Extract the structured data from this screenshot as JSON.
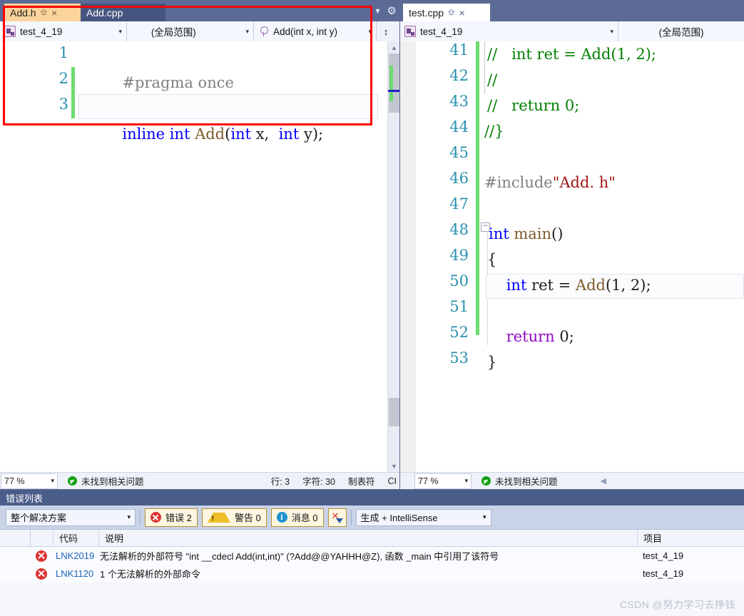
{
  "left_pane": {
    "tabs": [
      {
        "label": "Add.h",
        "state": "active",
        "pin": "pin-icon",
        "close": "×"
      },
      {
        "label": "Add.cpp",
        "state": "inactive"
      }
    ],
    "tab_controls": {
      "overflow": "▾",
      "settings": "gear-icon"
    },
    "nav": {
      "project": "test_4_19",
      "scope": "(全局范围)",
      "member": "Add(int x, int y)",
      "caret": "▾",
      "split": "↕"
    },
    "code": {
      "lines": [
        {
          "num": "1",
          "changed": false,
          "tokens": [
            {
              "t": "#pragma once",
              "c": "k-pre"
            }
          ]
        },
        {
          "num": "2",
          "changed": true,
          "tokens": []
        },
        {
          "num": "3",
          "changed": true,
          "tokens": [
            {
              "t": "inline ",
              "c": "k-kw"
            },
            {
              "t": "int ",
              "c": "k-kw"
            },
            {
              "t": "Add",
              "c": "k-fn"
            },
            {
              "t": "(",
              "c": "k-punct"
            },
            {
              "t": "int ",
              "c": "k-kw"
            },
            {
              "t": "x",
              "c": "k-id"
            },
            {
              "t": ",  ",
              "c": "k-punct"
            },
            {
              "t": "int ",
              "c": "k-kw"
            },
            {
              "t": "y",
              "c": "k-id"
            },
            {
              "t": ");",
              "c": "k-punct"
            }
          ]
        }
      ]
    },
    "status": {
      "zoom": "77 %",
      "zoom_caret": "▾",
      "health": "未找到相关问题",
      "line": "行: 3",
      "col": "字符: 30",
      "tabs_mode": "制表符",
      "encoding": "CI"
    }
  },
  "right_pane": {
    "tabs": [
      {
        "label": "test.cpp",
        "state": "white",
        "pin": "pin-icon",
        "close": "×"
      }
    ],
    "nav": {
      "project": "test_4_19",
      "scope": "(全局范围)",
      "caret": "▾"
    },
    "code": {
      "lines": [
        {
          "num": "41",
          "changed": true,
          "comment": true,
          "tokens": [
            {
              "t": "//   int ret = Add(1, 2);",
              "c": "k-cm"
            }
          ]
        },
        {
          "num": "42",
          "changed": true,
          "comment": true,
          "tokens": [
            {
              "t": "//",
              "c": "k-cm"
            }
          ]
        },
        {
          "num": "43",
          "changed": true,
          "comment": true,
          "tokens": [
            {
              "t": "//   return 0;",
              "c": "k-cm"
            }
          ]
        },
        {
          "num": "44",
          "changed": true,
          "comment": true,
          "tokens": [
            {
              "t": "//}",
              "c": "k-cm"
            }
          ]
        },
        {
          "num": "45",
          "changed": true,
          "tokens": []
        },
        {
          "num": "46",
          "changed": true,
          "tokens": [
            {
              "t": "#include",
              "c": "k-pre"
            },
            {
              "t": "\"Add. h\"",
              "c": "k-str"
            }
          ]
        },
        {
          "num": "47",
          "changed": true,
          "tokens": []
        },
        {
          "num": "48",
          "changed": true,
          "fold": "−",
          "tokens": [
            {
              "t": "int ",
              "c": "k-kw"
            },
            {
              "t": "main",
              "c": "k-fn"
            },
            {
              "t": "()",
              "c": "k-punct"
            }
          ]
        },
        {
          "num": "49",
          "changed": true,
          "tokens": [
            {
              "t": "{",
              "c": "k-punct"
            }
          ]
        },
        {
          "num": "50",
          "changed": true,
          "current": true,
          "tokens": [
            {
              "t": "    ",
              "c": "k-punct"
            },
            {
              "t": "int ",
              "c": "k-kw"
            },
            {
              "t": "ret",
              "c": "k-id"
            },
            {
              "t": " = ",
              "c": "k-punct"
            },
            {
              "t": "Add",
              "c": "k-fn"
            },
            {
              "t": "(1, 2);",
              "c": "k-punct"
            }
          ]
        },
        {
          "num": "51",
          "changed": true,
          "tokens": []
        },
        {
          "num": "52",
          "changed": true,
          "tokens": [
            {
              "t": "    ",
              "c": "k-punct"
            },
            {
              "t": "return ",
              "c": "k-ctl"
            },
            {
              "t": "0;",
              "c": "k-punct"
            }
          ]
        },
        {
          "num": "53",
          "changed": true,
          "tokens": [
            {
              "t": "}",
              "c": "k-punct"
            }
          ]
        }
      ]
    },
    "status": {
      "zoom": "77 %",
      "zoom_caret": "▾",
      "health": "未找到相关问题",
      "collapse": "◀"
    }
  },
  "error_list": {
    "title": "错误列表",
    "scope_filter": "整个解决方案",
    "scope_caret": "▾",
    "buttons": [
      {
        "label": "错误 2",
        "icon": "error-icon"
      },
      {
        "label": "警告 0",
        "icon": "warning-icon"
      },
      {
        "label": "消息 0",
        "icon": "info-icon"
      }
    ],
    "filter_button": "clear-filter-icon",
    "build_filter": "生成 + IntelliSense",
    "build_caret": "▾",
    "columns": {
      "code": "代码",
      "description": "说明",
      "project": "项目"
    },
    "rows": [
      {
        "icon": "error-icon",
        "code": "LNK2019",
        "description": "无法解析的外部符号 \"int __cdecl Add(int,int)\" (?Add@@YAHHH@Z), 函数 _main 中引用了该符号",
        "project": "test_4_19"
      },
      {
        "icon": "error-icon",
        "code": "LNK1120",
        "description": "1 个无法解析的外部命令",
        "project": "test_4_19"
      }
    ]
  },
  "watermark": "CSDN @努力学习去挣钱",
  "colors": {
    "chrome": "#5c6b96",
    "active_tab": "#fbd39c",
    "inactive_tab": "#46557f",
    "annotation": "#ff0000",
    "change_bar": "#6ddc70",
    "error": "#d33333",
    "link": "#1b62b8"
  }
}
